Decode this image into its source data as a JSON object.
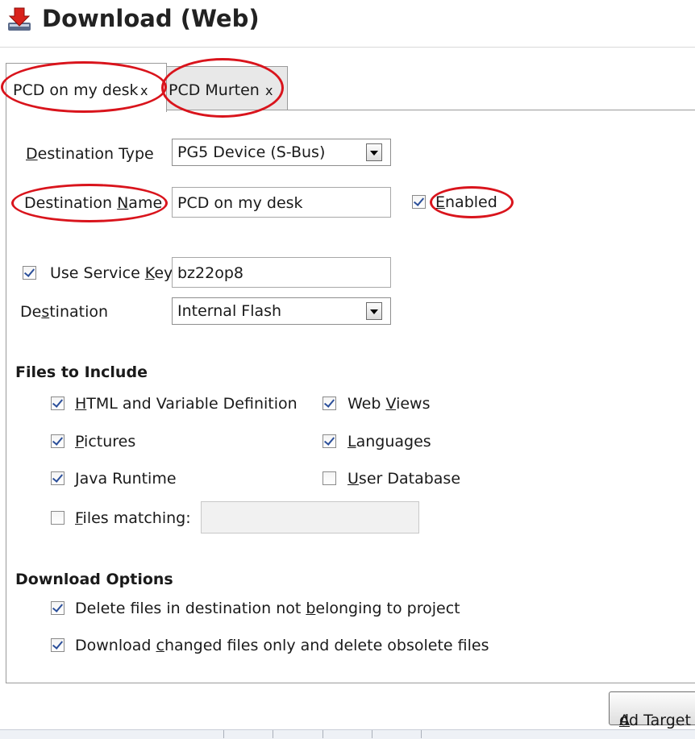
{
  "title": {
    "text": "Download (Web)",
    "icon": "download-arrow-icon"
  },
  "tabs": [
    {
      "label": "PCD on my desk",
      "close": "x",
      "active": true
    },
    {
      "label": "PCD Murten",
      "close": "x",
      "active": false
    }
  ],
  "form": {
    "destination_type": {
      "label_u": "D",
      "label_rest": "estination Type",
      "value": "PG5 Device (S-Bus)"
    },
    "destination_name": {
      "label_pre": "Destination ",
      "label_u": "N",
      "label_rest": "ame",
      "value": "PCD on my desk"
    },
    "enabled": {
      "label_u": "E",
      "label_rest": "nabled",
      "checked": true
    },
    "service_key": {
      "label_pre": "Use Service ",
      "label_u": "K",
      "label_rest": "ey",
      "checked": true,
      "value": "bz22op8"
    },
    "destination": {
      "label_pre": "De",
      "label_u": "s",
      "label_rest": "tination",
      "value": "Internal Flash"
    }
  },
  "files": {
    "heading": "Files to Include",
    "html_vars": {
      "label_u": "H",
      "label_rest": "TML and Variable Definition",
      "checked": true
    },
    "web_views": {
      "label_pre": "Web ",
      "label_u": "V",
      "label_rest": "iews",
      "checked": true
    },
    "pictures": {
      "label_u": "P",
      "label_rest": "ictures",
      "checked": true
    },
    "languages": {
      "label_u": "L",
      "label_rest": "anguages",
      "checked": true
    },
    "java_runtime": {
      "label_u": "J",
      "label_rest": "ava Runtime",
      "checked": true
    },
    "user_database": {
      "label_u": "U",
      "label_rest": "ser Database",
      "checked": false
    },
    "files_matching": {
      "label_u": "F",
      "label_rest": "iles matching:",
      "checked": false,
      "value": ""
    }
  },
  "download_options": {
    "heading": "Download Options",
    "delete_files": {
      "label_pre": "Delete files in destination not ",
      "label_u": "b",
      "label_rest": "elonging to project",
      "checked": true
    },
    "changed_only": {
      "label_pre": "Download ",
      "label_u": "c",
      "label_rest": "hanged files only and delete obsolete files",
      "checked": true
    }
  },
  "buttons": {
    "add_target": {
      "label_u": "A",
      "label_rest": "dd Target"
    }
  },
  "colors": {
    "highlight_ring": "#d9141c",
    "checkmark": "#2b4f9a"
  }
}
